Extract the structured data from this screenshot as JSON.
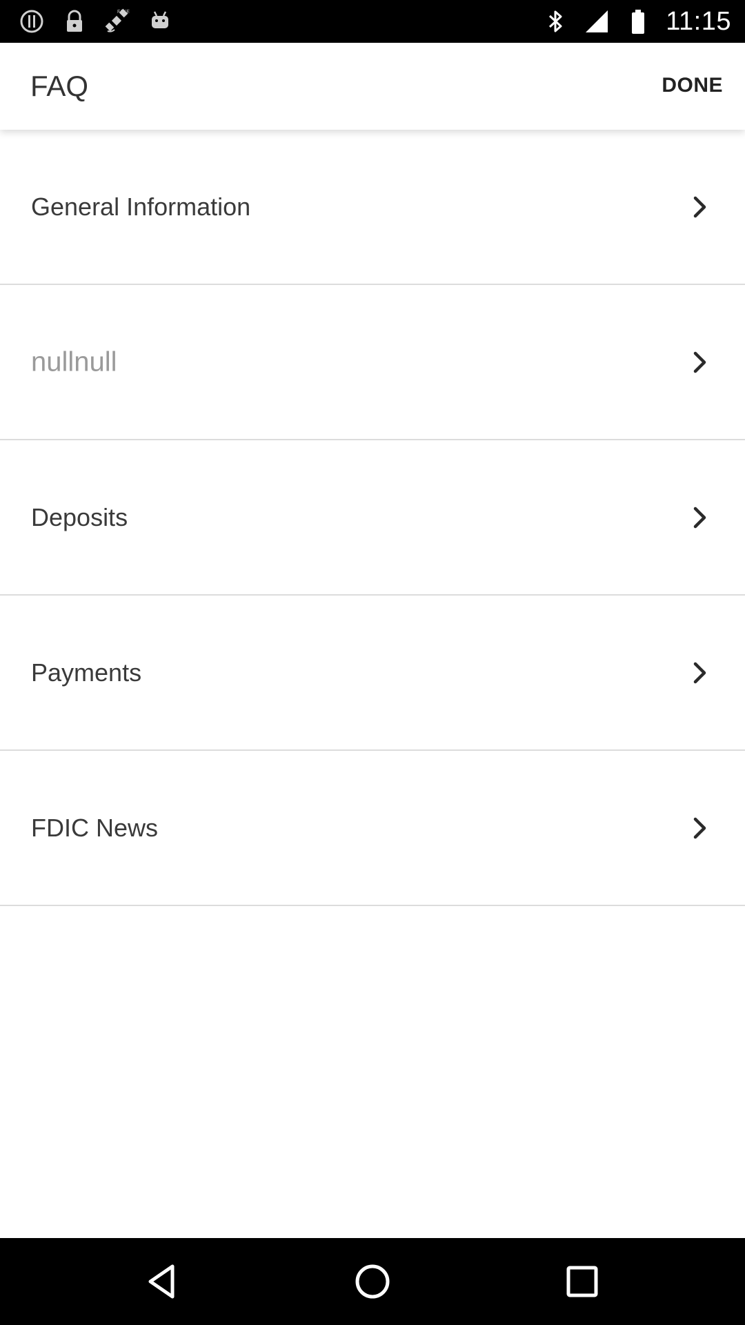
{
  "status_bar": {
    "time": "11:15",
    "left_icons": [
      "alert-icon",
      "lock-icon",
      "fake-gps-icon",
      "android-icon"
    ],
    "right_icons": [
      "bluetooth-icon",
      "signal-icon",
      "battery-icon"
    ]
  },
  "header": {
    "title": "FAQ",
    "done_label": "DONE"
  },
  "faq": {
    "items": [
      {
        "label": "General Information",
        "muted": false
      },
      {
        "label": "nullnull",
        "muted": true
      },
      {
        "label": "Deposits",
        "muted": false
      },
      {
        "label": "Payments",
        "muted": false
      },
      {
        "label": "FDIC News",
        "muted": false
      }
    ]
  },
  "nav_bar": {
    "buttons": [
      "back-icon",
      "home-icon",
      "recents-icon"
    ]
  },
  "colors": {
    "status_bar_bg": "#000000",
    "app_bar_bg": "#ffffff",
    "text_primary": "#3a3a3a",
    "text_muted": "#9a9a9a",
    "divider": "#dcdcdc"
  }
}
